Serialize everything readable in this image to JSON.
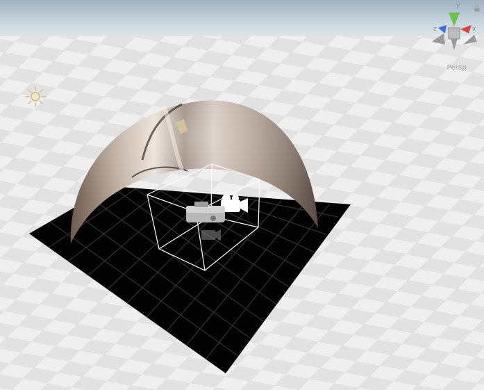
{
  "scene_view": {
    "projection_label": "Persp",
    "orientation_gizmo": {
      "axes": [
        {
          "axis": "y",
          "label": "y",
          "color": "#6cc24a"
        },
        {
          "axis": "x",
          "label": "x",
          "color": "#d8453a"
        },
        {
          "axis": "z",
          "label": "z",
          "color": "#3a6fd8"
        }
      ],
      "lock_icon": "lock-icon"
    },
    "objects": [
      {
        "name": "directional-light",
        "icon": "sun-icon"
      },
      {
        "name": "dome-screen",
        "icon": "dome-mesh"
      },
      {
        "name": "floor-plane",
        "icon": "black-grid-plane"
      },
      {
        "name": "camera-rig",
        "icon": "camera-icon"
      }
    ]
  }
}
